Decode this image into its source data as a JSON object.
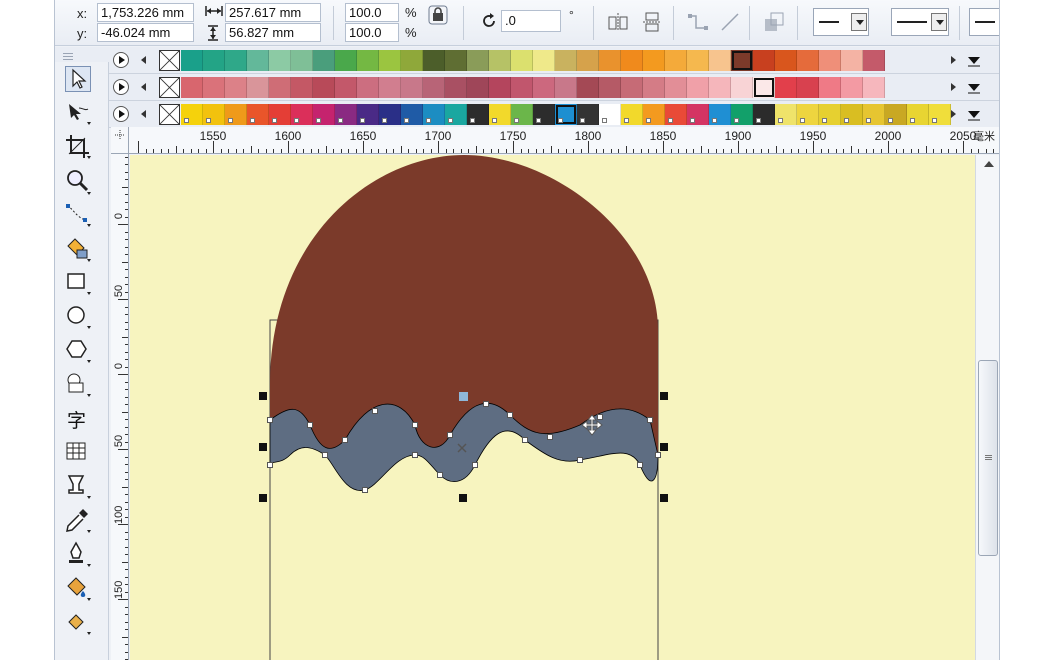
{
  "propbar": {
    "x_label": "x:",
    "x_value": "1,753.226 mm",
    "y_label": "y:",
    "y_value": "-46.024 mm",
    "width_value": "257.617 mm",
    "height_value": "56.827 mm",
    "scale_x": "100.0",
    "scale_y": "100.0",
    "percent": "%",
    "rotation_value": ".0",
    "degree": "°"
  },
  "ruler": {
    "h_labels": [
      "1550",
      "1600",
      "1650",
      "1700",
      "1750",
      "1800",
      "1850",
      "1900",
      "1950",
      "2000",
      "2050"
    ],
    "v_labels": [
      "0",
      "50",
      "0",
      "50",
      "100",
      "150"
    ],
    "unit": "毫米"
  },
  "tools": [
    "pick-tool-icon",
    "shape-tool-icon",
    "crop-tool-icon",
    "zoom-tool-icon",
    "freehand-tool-icon",
    "smart-fill-icon",
    "rectangle-tool-icon",
    "ellipse-tool-icon",
    "polygon-tool-icon",
    "basic-shapes-icon",
    "text-tool-icon",
    "table-tool-icon",
    "blend-tool-icon",
    "eyedropper-icon",
    "outline-pen-icon",
    "fill-tool-icon",
    "interactive-fill-icon"
  ],
  "text_tool_glyph": "字",
  "palette": {
    "row1": [
      "#1aa08a",
      "#23a486",
      "#2fa889",
      "#63b89a",
      "#8ccaa4",
      "#7fbf97",
      "#4a9e7c",
      "#4aa84b",
      "#74b843",
      "#9bc540",
      "#8fa83a",
      "#4c5e2a",
      "#5f6e33",
      "#8a9c59",
      "#b6c266",
      "#dbe06e",
      "#efe98a",
      "#c9b25f",
      "#d6a24b",
      "#e9922d",
      "#f08a1c",
      "#f39a1f",
      "#f4aa3a",
      "#f5b84e",
      "#f7c48e",
      "#7b3a2a",
      "#c8401f",
      "#d9561d",
      "#e56b3b",
      "#ef8f79",
      "#f4b3a4",
      "#c45a6a"
    ],
    "row1_selected": 25,
    "row2": [
      "#d8666e",
      "#da727a",
      "#dc8188",
      "#d9959a",
      "#cf6d76",
      "#c45865",
      "#b84a59",
      "#c3586a",
      "#cc6e80",
      "#d17e8f",
      "#c8788a",
      "#b86477",
      "#a95063",
      "#9f4659",
      "#b4455d",
      "#c1566d",
      "#cc687e",
      "#c8788a",
      "#a44955",
      "#b55a66",
      "#c66b76",
      "#d47c86",
      "#e28e97",
      "#f0a0a8",
      "#f5b6bb",
      "#f8d3d5",
      "#fbe8e8",
      "#e23f4b",
      "#d8414f",
      "#ef7a86",
      "#f39aa3",
      "#f6b7bd"
    ],
    "row2_selected": 26,
    "row3": [
      "#f5d20c",
      "#f2c20e",
      "#ef9a1a",
      "#e9552a",
      "#e43e36",
      "#db2f5a",
      "#c5236e",
      "#8a2a82",
      "#4a2a86",
      "#2a2f87",
      "#1f5ba6",
      "#1c8dc2",
      "#1aa7a0",
      "#2c2c2c",
      "#f2d92b",
      "#6bb64a",
      "#2c2c2c",
      "#1d8fd1",
      "#333333",
      "#ffffff",
      "#f2d92b",
      "#f39a1f",
      "#e94a37",
      "#d43463",
      "#1f8fd3",
      "#12a06a",
      "#2b2b2b",
      "#efe36a",
      "#eed53f",
      "#e6d030",
      "#d9be22",
      "#e6c531",
      "#c9a823",
      "#e8d532",
      "#f0de3b"
    ],
    "row3_selected": 17
  },
  "colors": {
    "page_bg": "#f7f4bf",
    "cap_fill": "#7b3a2a",
    "wave_fill": "#5e6d82",
    "stroke": "#000000",
    "window_bg": "#eef1f6"
  }
}
